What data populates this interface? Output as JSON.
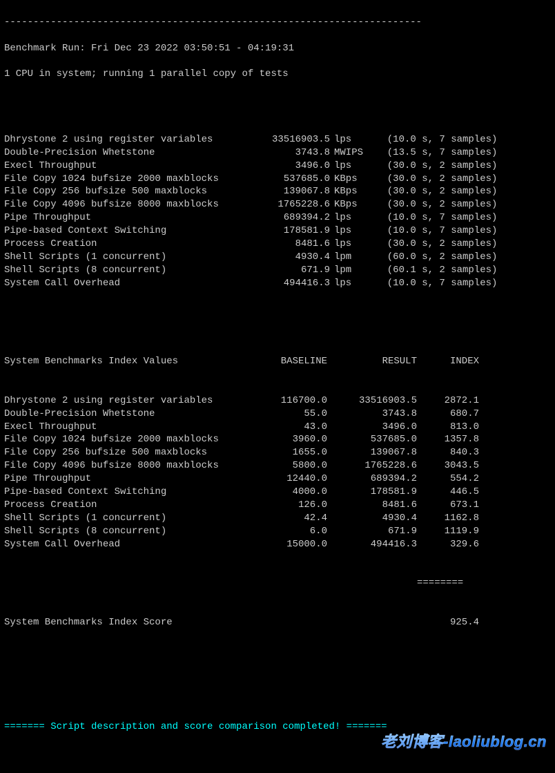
{
  "hr_top": "------------------------------------------------------------------------",
  "run_line": "Benchmark Run: Fri Dec 23 2022 03:50:51 - 04:19:31",
  "cpu_line": "1 CPU in system; running 1 parallel copy of tests",
  "rows": [
    {
      "name": "Dhrystone 2 using register variables",
      "value": "33516903.5",
      "unit": "lps",
      "time": "(10.0 s,",
      "samples": " 7 samples)"
    },
    {
      "name": "Double-Precision Whetstone",
      "value": "3743.8",
      "unit": "MWIPS",
      "time": "(13.5 s,",
      "samples": " 7 samples)"
    },
    {
      "name": "Execl Throughput",
      "value": "3496.0",
      "unit": "lps",
      "time": "(30.0 s,",
      "samples": " 2 samples)"
    },
    {
      "name": "File Copy 1024 bufsize 2000 maxblocks",
      "value": "537685.0",
      "unit": "KBps",
      "time": "(30.0 s,",
      "samples": " 2 samples)"
    },
    {
      "name": "File Copy 256 bufsize 500 maxblocks",
      "value": "139067.8",
      "unit": "KBps",
      "time": "(30.0 s,",
      "samples": " 2 samples)"
    },
    {
      "name": "File Copy 4096 bufsize 8000 maxblocks",
      "value": "1765228.6",
      "unit": "KBps",
      "time": "(30.0 s,",
      "samples": " 2 samples)"
    },
    {
      "name": "Pipe Throughput",
      "value": "689394.2",
      "unit": "lps",
      "time": "(10.0 s,",
      "samples": " 7 samples)"
    },
    {
      "name": "Pipe-based Context Switching",
      "value": "178581.9",
      "unit": "lps",
      "time": "(10.0 s,",
      "samples": " 7 samples)"
    },
    {
      "name": "Process Creation",
      "value": "8481.6",
      "unit": "lps",
      "time": "(30.0 s,",
      "samples": " 2 samples)"
    },
    {
      "name": "Shell Scripts (1 concurrent)",
      "value": "4930.4",
      "unit": "lpm",
      "time": "(60.0 s,",
      "samples": " 2 samples)"
    },
    {
      "name": "Shell Scripts (8 concurrent)",
      "value": "671.9",
      "unit": "lpm",
      "time": "(60.1 s,",
      "samples": " 2 samples)"
    },
    {
      "name": "System Call Overhead",
      "value": "494416.3",
      "unit": "lps",
      "time": "(10.0 s,",
      "samples": " 7 samples)"
    }
  ],
  "index_header": {
    "name": "System Benchmarks Index Values",
    "baseline": "BASELINE",
    "result": "RESULT",
    "index": "INDEX"
  },
  "index_rows": [
    {
      "name": "Dhrystone 2 using register variables",
      "baseline": "116700.0",
      "result": "33516903.5",
      "index": "2872.1"
    },
    {
      "name": "Double-Precision Whetstone",
      "baseline": "55.0",
      "result": "3743.8",
      "index": "680.7"
    },
    {
      "name": "Execl Throughput",
      "baseline": "43.0",
      "result": "3496.0",
      "index": "813.0"
    },
    {
      "name": "File Copy 1024 bufsize 2000 maxblocks",
      "baseline": "3960.0",
      "result": "537685.0",
      "index": "1357.8"
    },
    {
      "name": "File Copy 256 bufsize 500 maxblocks",
      "baseline": "1655.0",
      "result": "139067.8",
      "index": "840.3"
    },
    {
      "name": "File Copy 4096 bufsize 8000 maxblocks",
      "baseline": "5800.0",
      "result": "1765228.6",
      "index": "3043.5"
    },
    {
      "name": "Pipe Throughput",
      "baseline": "12440.0",
      "result": "689394.2",
      "index": "554.2"
    },
    {
      "name": "Pipe-based Context Switching",
      "baseline": "4000.0",
      "result": "178581.9",
      "index": "446.5"
    },
    {
      "name": "Process Creation",
      "baseline": "126.0",
      "result": "8481.6",
      "index": "673.1"
    },
    {
      "name": "Shell Scripts (1 concurrent)",
      "baseline": "42.4",
      "result": "4930.4",
      "index": "1162.8"
    },
    {
      "name": "Shell Scripts (8 concurrent)",
      "baseline": "6.0",
      "result": "671.9",
      "index": "1119.9"
    },
    {
      "name": "System Call Overhead",
      "baseline": "15000.0",
      "result": "494416.3",
      "index": "329.6"
    }
  ],
  "score_label": "System Benchmarks Index Score",
  "score_value": "925.4",
  "footer_line": "======= Script description and score comparison completed! =======",
  "watermark": "老刘博客-laoliublog.cn"
}
